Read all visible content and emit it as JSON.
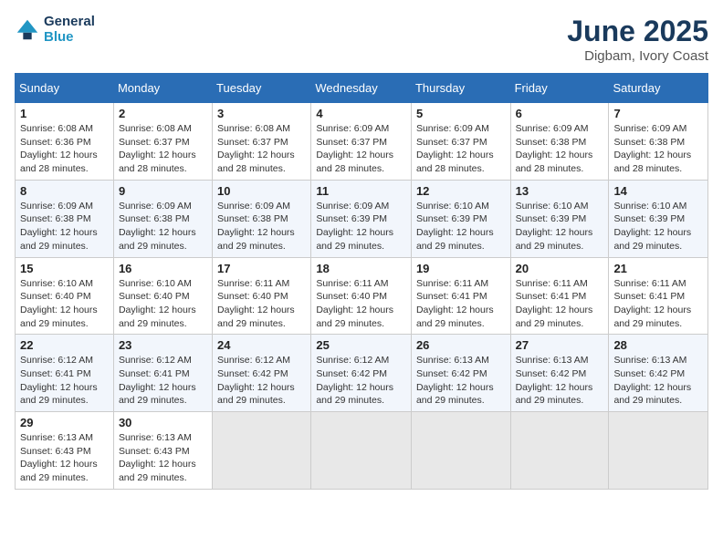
{
  "logo": {
    "line1": "General",
    "line2": "Blue"
  },
  "title": "June 2025",
  "subtitle": "Digbam, Ivory Coast",
  "days_of_week": [
    "Sunday",
    "Monday",
    "Tuesday",
    "Wednesday",
    "Thursday",
    "Friday",
    "Saturday"
  ],
  "weeks": [
    [
      {
        "day": "1",
        "rise": "6:08 AM",
        "set": "6:36 PM",
        "hours": "12 hours",
        "mins": "28"
      },
      {
        "day": "2",
        "rise": "6:08 AM",
        "set": "6:37 PM",
        "hours": "12 hours",
        "mins": "28"
      },
      {
        "day": "3",
        "rise": "6:08 AM",
        "set": "6:37 PM",
        "hours": "12 hours",
        "mins": "28"
      },
      {
        "day": "4",
        "rise": "6:09 AM",
        "set": "6:37 PM",
        "hours": "12 hours",
        "mins": "28"
      },
      {
        "day": "5",
        "rise": "6:09 AM",
        "set": "6:37 PM",
        "hours": "12 hours",
        "mins": "28"
      },
      {
        "day": "6",
        "rise": "6:09 AM",
        "set": "6:38 PM",
        "hours": "12 hours",
        "mins": "28"
      },
      {
        "day": "7",
        "rise": "6:09 AM",
        "set": "6:38 PM",
        "hours": "12 hours",
        "mins": "28"
      }
    ],
    [
      {
        "day": "8",
        "rise": "6:09 AM",
        "set": "6:38 PM",
        "hours": "12 hours",
        "mins": "29"
      },
      {
        "day": "9",
        "rise": "6:09 AM",
        "set": "6:38 PM",
        "hours": "12 hours",
        "mins": "29"
      },
      {
        "day": "10",
        "rise": "6:09 AM",
        "set": "6:38 PM",
        "hours": "12 hours",
        "mins": "29"
      },
      {
        "day": "11",
        "rise": "6:09 AM",
        "set": "6:39 PM",
        "hours": "12 hours",
        "mins": "29"
      },
      {
        "day": "12",
        "rise": "6:10 AM",
        "set": "6:39 PM",
        "hours": "12 hours",
        "mins": "29"
      },
      {
        "day": "13",
        "rise": "6:10 AM",
        "set": "6:39 PM",
        "hours": "12 hours",
        "mins": "29"
      },
      {
        "day": "14",
        "rise": "6:10 AM",
        "set": "6:39 PM",
        "hours": "12 hours",
        "mins": "29"
      }
    ],
    [
      {
        "day": "15",
        "rise": "6:10 AM",
        "set": "6:40 PM",
        "hours": "12 hours",
        "mins": "29"
      },
      {
        "day": "16",
        "rise": "6:10 AM",
        "set": "6:40 PM",
        "hours": "12 hours",
        "mins": "29"
      },
      {
        "day": "17",
        "rise": "6:11 AM",
        "set": "6:40 PM",
        "hours": "12 hours",
        "mins": "29"
      },
      {
        "day": "18",
        "rise": "6:11 AM",
        "set": "6:40 PM",
        "hours": "12 hours",
        "mins": "29"
      },
      {
        "day": "19",
        "rise": "6:11 AM",
        "set": "6:41 PM",
        "hours": "12 hours",
        "mins": "29"
      },
      {
        "day": "20",
        "rise": "6:11 AM",
        "set": "6:41 PM",
        "hours": "12 hours",
        "mins": "29"
      },
      {
        "day": "21",
        "rise": "6:11 AM",
        "set": "6:41 PM",
        "hours": "12 hours",
        "mins": "29"
      }
    ],
    [
      {
        "day": "22",
        "rise": "6:12 AM",
        "set": "6:41 PM",
        "hours": "12 hours",
        "mins": "29"
      },
      {
        "day": "23",
        "rise": "6:12 AM",
        "set": "6:41 PM",
        "hours": "12 hours",
        "mins": "29"
      },
      {
        "day": "24",
        "rise": "6:12 AM",
        "set": "6:42 PM",
        "hours": "12 hours",
        "mins": "29"
      },
      {
        "day": "25",
        "rise": "6:12 AM",
        "set": "6:42 PM",
        "hours": "12 hours",
        "mins": "29"
      },
      {
        "day": "26",
        "rise": "6:13 AM",
        "set": "6:42 PM",
        "hours": "12 hours",
        "mins": "29"
      },
      {
        "day": "27",
        "rise": "6:13 AM",
        "set": "6:42 PM",
        "hours": "12 hours",
        "mins": "29"
      },
      {
        "day": "28",
        "rise": "6:13 AM",
        "set": "6:42 PM",
        "hours": "12 hours",
        "mins": "29"
      }
    ],
    [
      {
        "day": "29",
        "rise": "6:13 AM",
        "set": "6:43 PM",
        "hours": "12 hours",
        "mins": "29"
      },
      {
        "day": "30",
        "rise": "6:13 AM",
        "set": "6:43 PM",
        "hours": "12 hours",
        "mins": "29"
      },
      null,
      null,
      null,
      null,
      null
    ]
  ]
}
